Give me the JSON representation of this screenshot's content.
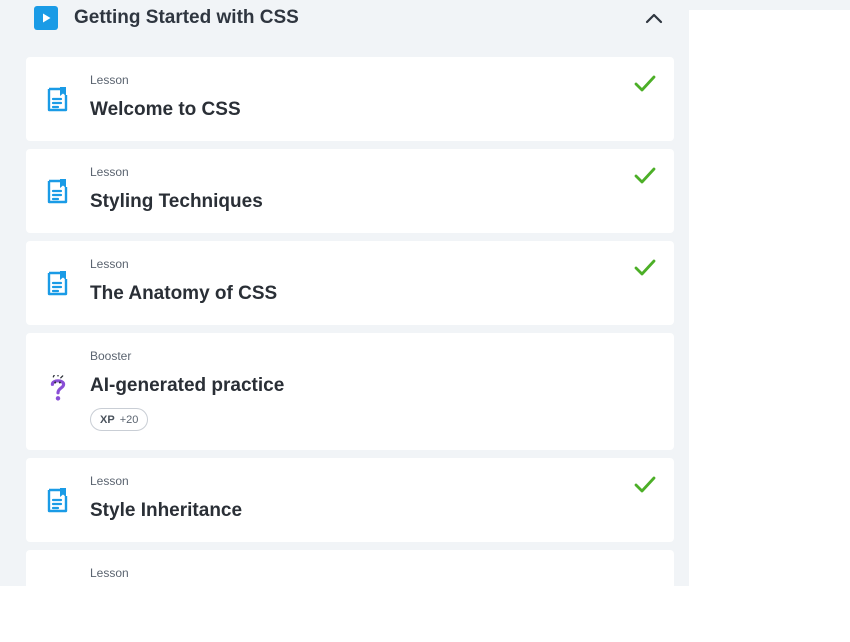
{
  "module": {
    "title": "Getting Started with CSS",
    "icon": "play-icon",
    "accent": "#1a9be6"
  },
  "items": [
    {
      "type": "Lesson",
      "title": "Welcome to CSS",
      "completed": true
    },
    {
      "type": "Lesson",
      "title": "Styling Techniques",
      "completed": true
    },
    {
      "type": "Lesson",
      "title": "The Anatomy of CSS",
      "completed": true
    },
    {
      "type": "Booster",
      "title": "AI-generated practice",
      "completed": false,
      "xp_label": "XP",
      "xp_value": "+20"
    },
    {
      "type": "Lesson",
      "title": "Style Inheritance",
      "completed": true
    },
    {
      "type": "Lesson",
      "title": "",
      "completed": false
    }
  ],
  "colors": {
    "check": "#4caf27",
    "lesson_icon": "#1a9be6",
    "booster_icon": "#8a4fd6"
  }
}
